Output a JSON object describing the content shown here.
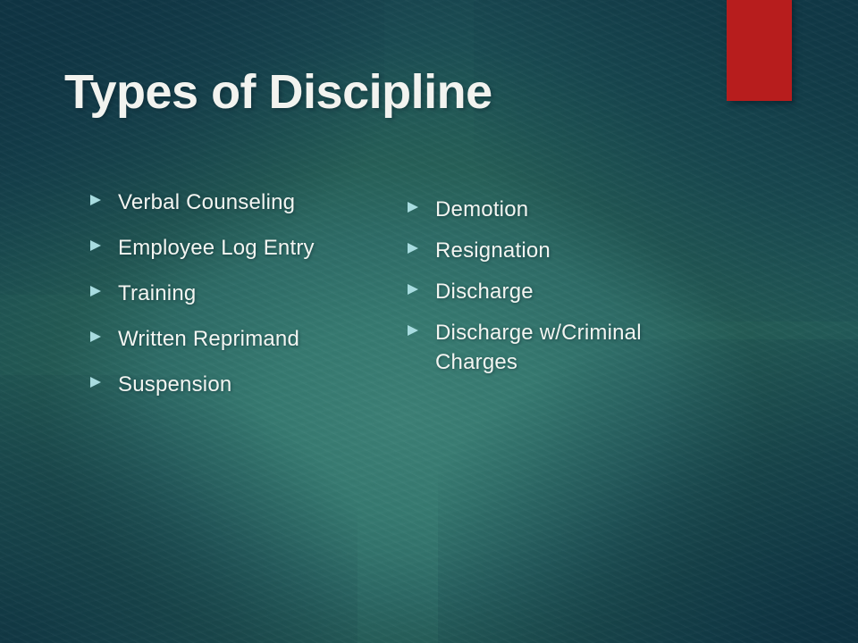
{
  "slide": {
    "title": "Types of Discipline",
    "accent_bar_color": "#b71d1d",
    "background_colors": {
      "center_glow": "#3d8076",
      "edge_dark": "#17404f",
      "corner_dark": "#153c4c"
    },
    "text_color": "#f2f3ef",
    "bullet_marker_color": "#a8dce0",
    "bullet_marker_icon": "triangle-right-icon"
  },
  "columns": [
    {
      "name": "left-column",
      "items": [
        {
          "label": "Verbal Counseling"
        },
        {
          "label": "Employee Log Entry"
        },
        {
          "label": "Training"
        },
        {
          "label": "Written Reprimand"
        },
        {
          "label": "Suspension"
        }
      ]
    },
    {
      "name": "right-column",
      "items": [
        {
          "label": "Demotion"
        },
        {
          "label": "Resignation"
        },
        {
          "label": "Discharge"
        },
        {
          "label": "Discharge w/Criminal Charges"
        }
      ]
    }
  ]
}
